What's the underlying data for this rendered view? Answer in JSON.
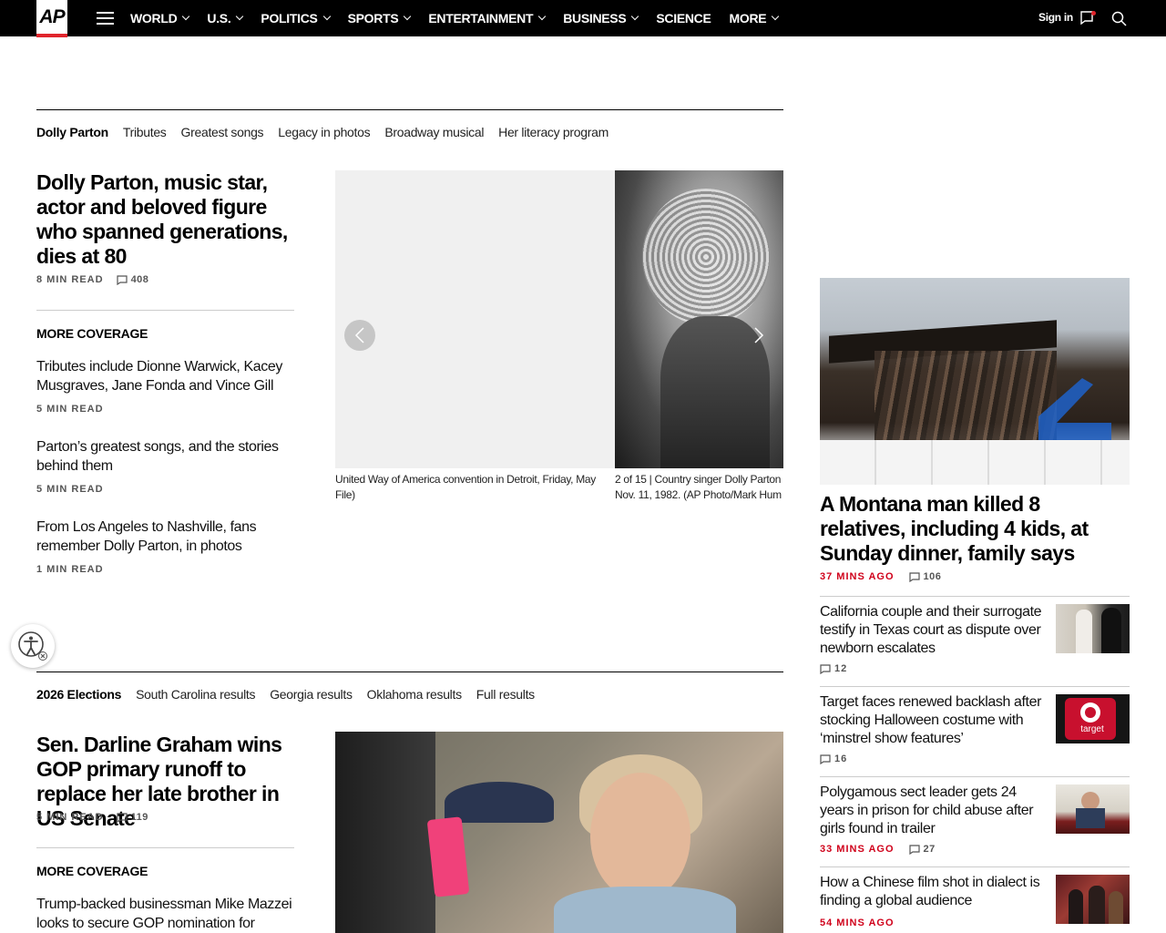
{
  "nav": {
    "logo": "AP",
    "items": [
      {
        "label": "WORLD",
        "dropdown": true
      },
      {
        "label": "U.S.",
        "dropdown": true
      },
      {
        "label": "POLITICS",
        "dropdown": true
      },
      {
        "label": "SPORTS",
        "dropdown": true
      },
      {
        "label": "ENTERTAINMENT",
        "dropdown": true
      },
      {
        "label": "BUSINESS",
        "dropdown": true
      },
      {
        "label": "SCIENCE",
        "dropdown": false
      },
      {
        "label": "MORE",
        "dropdown": true
      }
    ],
    "signin": "Sign in"
  },
  "section1": {
    "subnav": [
      "Dolly Parton",
      "Tributes",
      "Greatest songs",
      "Legacy in photos",
      "Broadway musical",
      "Her literacy program"
    ],
    "headline": "Dolly Parton, music star, actor and beloved figure who spanned generations, dies at 80",
    "read_time": "8 MIN READ",
    "comments": "408",
    "more_coverage": "MORE COVERAGE",
    "coverage": [
      {
        "title": "Tributes include Dionne Warwick, Kacey Musgraves, Jane Fonda and Vince Gill",
        "meta": "5 MIN READ"
      },
      {
        "title": "Parton’s greatest songs, and the stories behind them",
        "meta": "5 MIN READ"
      },
      {
        "title": "From Los Angeles to Nashville, fans remember Dolly Parton, in photos",
        "meta": "1 MIN READ"
      }
    ],
    "captions": {
      "left_line1": "United Way of America convention in Detroit, Friday, May",
      "left_line2": "File)",
      "right_line1": "2 of 15 |  Country singer Dolly Parton",
      "right_line2": "Nov. 11, 1982. (AP Photo/Mark Hum"
    }
  },
  "section2": {
    "subnav": [
      "2026 Elections",
      "South Carolina results",
      "Georgia results",
      "Oklahoma results",
      "Full results"
    ],
    "headline": "Sen. Darline Graham wins GOP primary runoff to replace her late brother in US Senate",
    "read_time": "5 MIN READ",
    "comments": "119",
    "more_coverage": "MORE COVERAGE",
    "coverage": [
      {
        "title": "Trump-backed businessman Mike Mazzei looks to secure GOP nomination for Oklahoma"
      }
    ]
  },
  "rail": {
    "lead": {
      "headline": "A Montana man killed 8 relatives, including 4 kids, at Sunday dinner, family says",
      "time": "37 MINS AGO",
      "comments": "106"
    },
    "items": [
      {
        "title": "California couple and their surrogate testify in Texas court as dispute over newborn escalates",
        "time": "",
        "comments": "12"
      },
      {
        "title": "Target faces renewed backlash after stocking Halloween costume with ‘minstrel show features’",
        "time": "",
        "comments": "16"
      },
      {
        "title": "Polygamous sect leader gets 24 years in prison for child abuse after girls found in trailer",
        "time": "33 MINS AGO",
        "comments": "27"
      },
      {
        "title": "How a Chinese film shot in dialect is finding a global audience",
        "time": "54 MINS AGO",
        "comments": ""
      }
    ],
    "target_text": "target"
  },
  "colors": {
    "accent_red": "#d0021b",
    "nav_bg": "#000000"
  }
}
